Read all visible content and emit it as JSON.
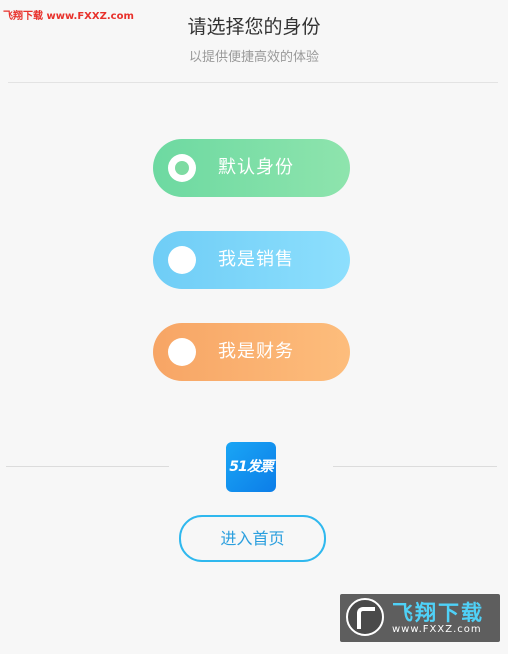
{
  "watermark": {
    "top_text": "飞翔下载 www.FXXZ.com",
    "bottom_brand": "飞翔下载",
    "bottom_url": "www.FXXZ.com"
  },
  "header": {
    "title": "请选择您的身份",
    "subtitle": "以提供便捷高效的体验"
  },
  "identity_options": [
    {
      "label": "默认身份",
      "selected": true,
      "color": "#7ddba2"
    },
    {
      "label": "我是销售",
      "selected": false,
      "color": "#7ed6fa"
    },
    {
      "label": "我是财务",
      "selected": false,
      "color": "#fbb170"
    }
  ],
  "logo": {
    "text": "51发票",
    "color": "#1490ee"
  },
  "enter_button": {
    "label": "进入首页",
    "color": "#2fb8ee"
  }
}
